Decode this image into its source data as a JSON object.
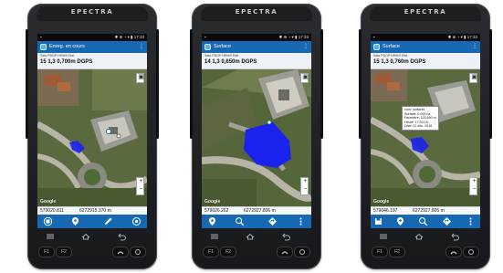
{
  "brand": "EPECTRA",
  "status": {
    "time": "17:33",
    "icons": "✱ ⊕ ◔ ▾ ▮"
  },
  "devices": [
    {
      "title": "Enreg. en cours",
      "info_headers": "Sats PDOP HRMS  Etat",
      "info_values": "15  1,3  0,700m  DGPS",
      "coord_x": "579020.811",
      "coord_y": "6272915.370 m",
      "toolbar_icons": [
        "stop-record-icon",
        "pin-icon",
        "pencil-icon",
        "target-icon"
      ]
    },
    {
      "title": "Surface",
      "info_headers": "Sats PDOP HRMS  Etat",
      "info_values": "14  1,3  0,650m  DGPS",
      "coord_x": "579026.262",
      "coord_y": "6272927.806 m",
      "toolbar_icons": [
        "pin-icon",
        "search-icon",
        "navigate-icon",
        "more-icon"
      ]
    },
    {
      "title": "Surface",
      "info_headers": "Sats PDOP HRMS  Etat",
      "info_values": "15  1,3  0,760m  DGPS",
      "coord_x": "579046.197",
      "coord_y": "6272927.805 m",
      "toolbar_icons": [
        "save-icon",
        "pin-icon",
        "search-icon",
        "navigate-icon",
        "more-icon"
      ],
      "callout": [
        "nom: surface1",
        "Surface: 0.053 ha",
        "Périmètre: 103.690 m",
        "Heure: 17:03:16",
        "Date: 11 déc. 2018"
      ]
    }
  ],
  "map_label": "Google",
  "function_keys": [
    "F1",
    "F2"
  ],
  "colors": {
    "accent": "#1769b4",
    "polygon": "#1a22ee"
  }
}
